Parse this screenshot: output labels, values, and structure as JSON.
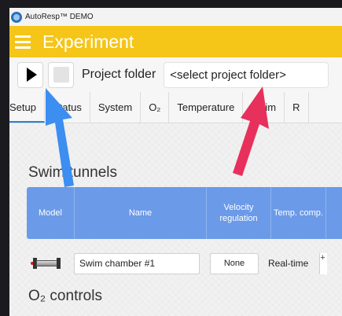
{
  "window": {
    "title": "AutoResp™ DEMO"
  },
  "appbar": {
    "title": "Experiment"
  },
  "toolbar": {
    "folder_label": "Project folder",
    "folder_value": "<select project folder>"
  },
  "tabs": [
    {
      "label": "Setup",
      "active": true
    },
    {
      "label": "Status"
    },
    {
      "label": "System"
    },
    {
      "label": "O₂"
    },
    {
      "label": "Temperature"
    },
    {
      "label": "Swim"
    },
    {
      "label": "R"
    }
  ],
  "swim_tunnels": {
    "title": "Swim tunnels",
    "headers": {
      "model": "Model",
      "name": "Name",
      "velocity": "Velocity regulation",
      "temp": "Temp. comp."
    },
    "rows": [
      {
        "name": "Swim chamber #1",
        "velocity": "None",
        "temp": "Real-time",
        "extra": "+"
      }
    ]
  },
  "o2_controls": {
    "title": "O₂ controls"
  },
  "colors": {
    "appbar": "#f5c518",
    "table_header": "#6b9ae8",
    "arrow_blue": "#3c8ef0",
    "arrow_red": "#e8305c"
  }
}
